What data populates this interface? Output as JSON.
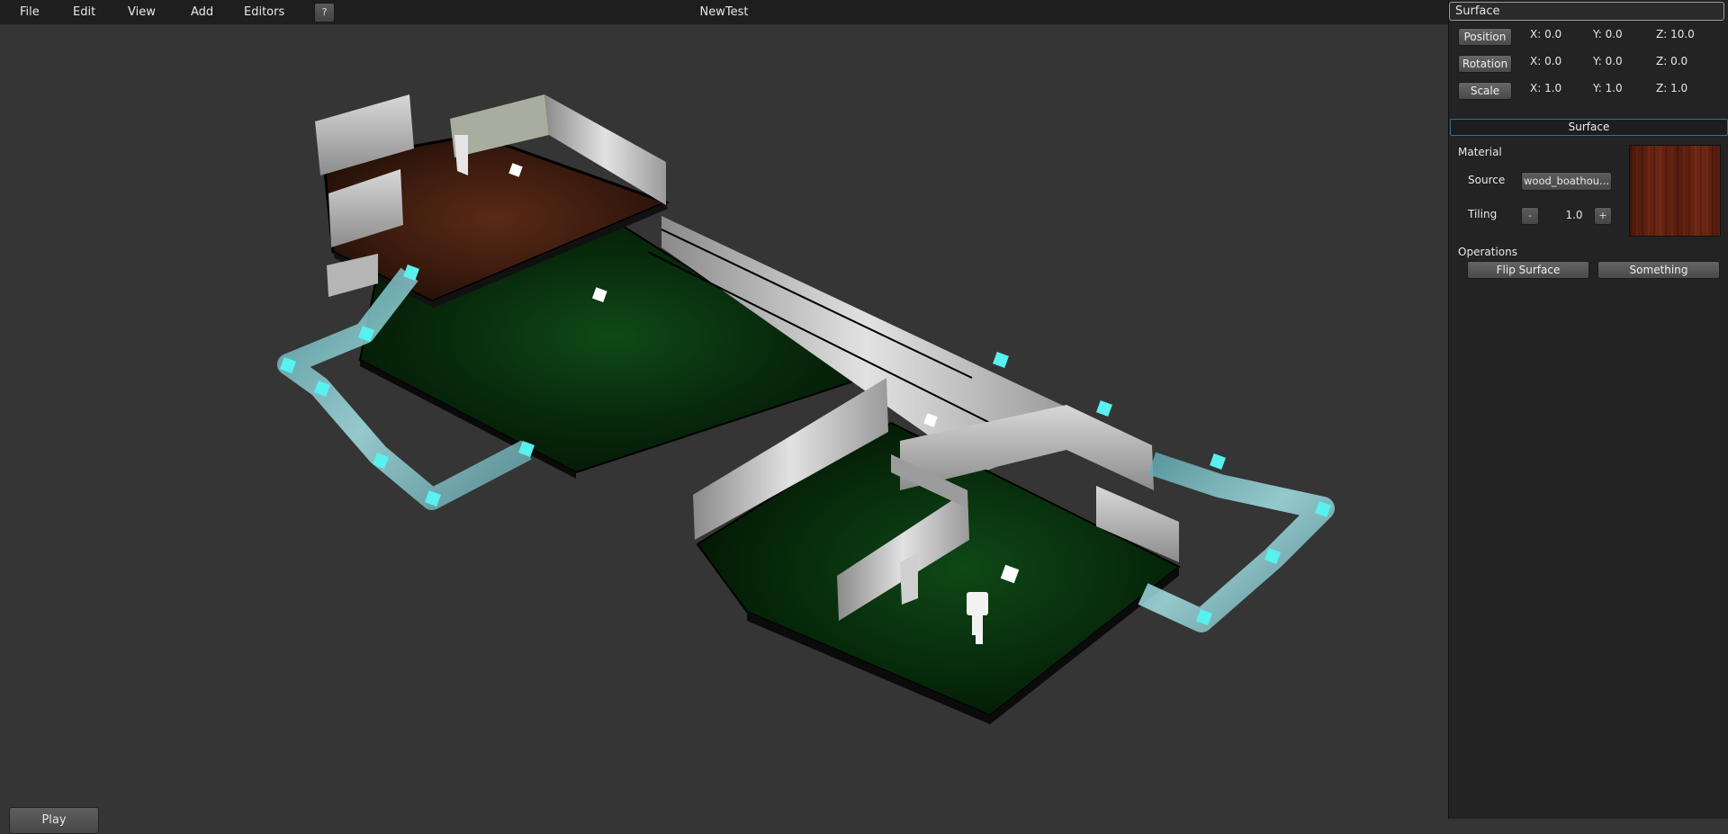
{
  "menu": {
    "file": "File",
    "edit": "Edit",
    "view": "View",
    "add": "Add",
    "editors": "Editors",
    "help": "?"
  },
  "document_title": "NewTest",
  "viewport": {
    "play_label": "Play"
  },
  "inspector": {
    "object_name": "Surface",
    "transform": {
      "position_label": "Position",
      "position": {
        "x": "X: 0.0",
        "y": "Y: 0.0",
        "z": "Z: 10.0"
      },
      "rotation_label": "Rotation",
      "rotation": {
        "x": "X: 0.0",
        "y": "Y: 0.0",
        "z": "Z: 0.0"
      },
      "scale_label": "Scale",
      "scale": {
        "x": "X: 1.0",
        "y": "Y: 1.0",
        "z": "Z: 1.0"
      }
    },
    "surface": {
      "header": "Surface",
      "material_label": "Material",
      "source_label": "Source",
      "source_value": "wood_boathou...",
      "tiling_label": "Tiling",
      "tiling_minus": "-",
      "tiling_value": "1.0",
      "tiling_plus": "+",
      "operations_label": "Operations",
      "flip_surface": "Flip Surface",
      "something": "Something"
    }
  },
  "colors": {
    "menubar": "#1e1e1e",
    "viewport_bg": "#353535",
    "panel_bg": "#232323",
    "accent_border": "#3b6e8e",
    "light_marker": "#59f0f0",
    "floor_green": "#0d3a12",
    "floor_wood": "#4e2414"
  },
  "icons": {
    "light_marker": "cube-light-icon",
    "help": "question-mark-icon"
  }
}
